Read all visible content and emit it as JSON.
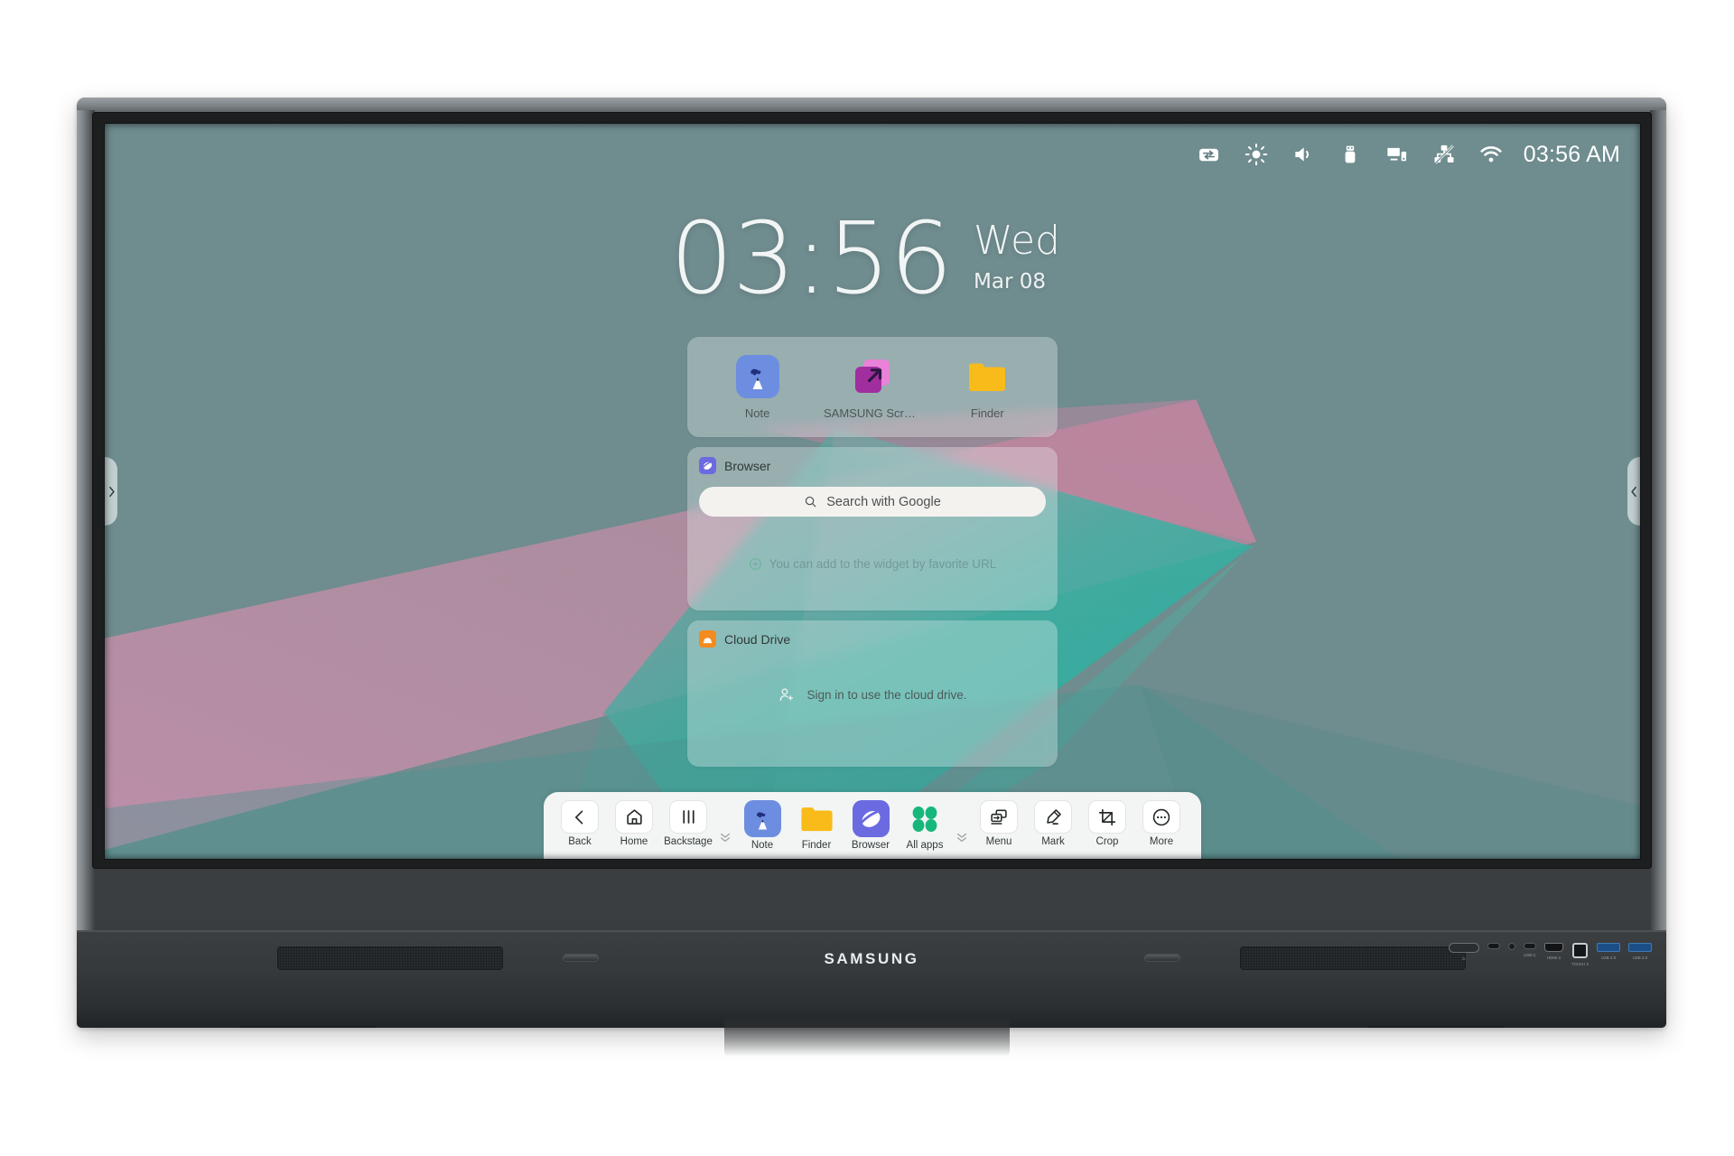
{
  "device": {
    "brand": "SAMSUNG",
    "ports": [
      {
        "name": "power-button",
        "label": "⏻",
        "type": "power"
      },
      {
        "name": "usb-c-port",
        "label": "",
        "type": "usbc"
      },
      {
        "name": "audio-jack",
        "label": "",
        "type": "jack"
      },
      {
        "name": "usb-c-data-port",
        "label": "USB-C",
        "type": "usbc"
      },
      {
        "name": "hdmi-port",
        "label": "HDMI 3",
        "type": "hdmi"
      },
      {
        "name": "touch-usb-b-port",
        "label": "TOUCH 3",
        "type": "usbb"
      },
      {
        "name": "usb-a-port-1",
        "label": "USB 3.0",
        "type": "usba"
      },
      {
        "name": "usb-a-port-2",
        "label": "USB 3.0",
        "type": "usba"
      }
    ]
  },
  "statusbar": {
    "clock": "03:56 AM",
    "icons": [
      {
        "name": "input-source-icon",
        "title": "Input source"
      },
      {
        "name": "brightness-icon",
        "title": "Brightness"
      },
      {
        "name": "volume-icon",
        "title": "Volume"
      },
      {
        "name": "usb-storage-icon",
        "title": "USB storage"
      },
      {
        "name": "screen-share-icon",
        "title": "Screen share"
      },
      {
        "name": "network-disconnected-icon",
        "title": "Network disconnected"
      },
      {
        "name": "wifi-icon",
        "title": "Wi-Fi"
      }
    ]
  },
  "clock_widget": {
    "time": "03:56",
    "day_of_week": "Wed",
    "date": "Mar 08"
  },
  "shortcuts_widget": {
    "items": [
      {
        "label": "Note",
        "icon": "note-icon"
      },
      {
        "label": "SAMSUNG Screen...",
        "icon": "samsung-screen-icon"
      },
      {
        "label": "Finder",
        "icon": "finder-icon"
      }
    ]
  },
  "browser_widget": {
    "title": "Browser",
    "icon": "browser-icon",
    "search_placeholder": "Search with Google",
    "hint": "You can add to the widget by favorite URL",
    "add_icon": "plus-circle-icon"
  },
  "cloud_widget": {
    "title": "Cloud Drive",
    "icon": "cloud-drive-icon",
    "sign_in_text": "Sign in to use the cloud drive.",
    "sign_in_icon": "add-user-icon"
  },
  "taskbar": {
    "nav": [
      {
        "label": "Back",
        "icon": "chevron-left-icon"
      },
      {
        "label": "Home",
        "icon": "home-icon"
      },
      {
        "label": "Backstage",
        "icon": "backstage-icon"
      }
    ],
    "apps": [
      {
        "label": "Note",
        "icon": "note-icon"
      },
      {
        "label": "Finder",
        "icon": "finder-icon"
      },
      {
        "label": "Browser",
        "icon": "browser-icon"
      },
      {
        "label": "All apps",
        "icon": "all-apps-icon"
      }
    ],
    "tools": [
      {
        "label": "Menu",
        "icon": "menu-windows-icon"
      },
      {
        "label": "Mark",
        "icon": "pen-icon"
      },
      {
        "label": "Crop",
        "icon": "crop-icon"
      },
      {
        "label": "More",
        "icon": "more-dots-icon"
      }
    ],
    "collapse_icon": "double-chevron-down-icon"
  },
  "side_tabs": [
    {
      "name": "left-handle",
      "icon": "chevron-right-icon"
    },
    {
      "name": "right-handle",
      "icon": "chevron-left-icon"
    }
  ],
  "colors": {
    "wallpaper_base": "#6f8c8e",
    "accent_teal": "#3fb59f",
    "accent_pink": "#d98ba6",
    "taskbar_bg": "#f2f5f4",
    "note_blue": "#6d8ee0",
    "finder_yellow": "#f9bb19",
    "browser_purple": "#6c6ae0",
    "cloud_orange": "#f38b1f"
  }
}
